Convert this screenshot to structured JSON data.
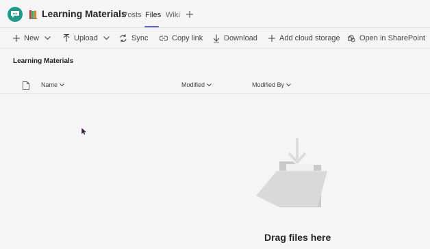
{
  "header": {
    "channel_title": "Learning Materials",
    "tabs": [
      {
        "label": "Posts",
        "active": false
      },
      {
        "label": "Files",
        "active": true
      },
      {
        "label": "Wiki",
        "active": false
      }
    ],
    "accent_color": "#5b5fc7",
    "app_color": "#1b9b8a"
  },
  "toolbar": {
    "new_label": "New",
    "upload_label": "Upload",
    "sync_label": "Sync",
    "copy_link_label": "Copy link",
    "download_label": "Download",
    "add_cloud_storage_label": "Add cloud storage",
    "open_sharepoint_label": "Open in SharePoint"
  },
  "library": {
    "title": "Learning Materials",
    "columns": [
      "Name",
      "Modified",
      "Modified By"
    ]
  },
  "empty_state": {
    "message": "Drag files here"
  }
}
